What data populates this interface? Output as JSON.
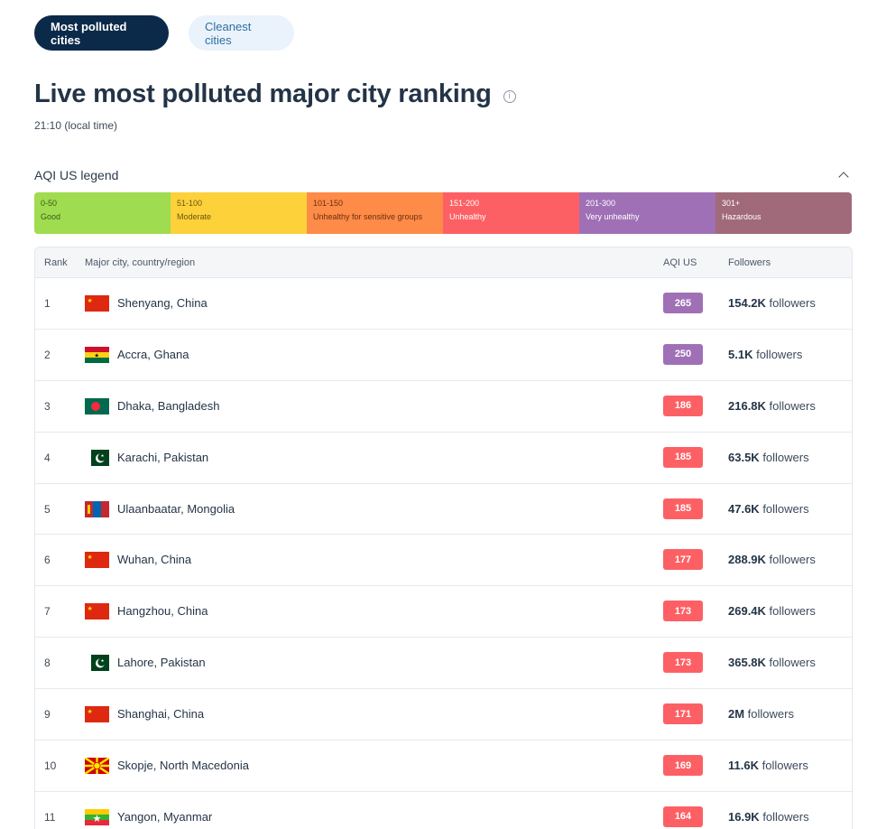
{
  "tabs": [
    {
      "label": "Most polluted cities",
      "active": true
    },
    {
      "label": "Cleanest cities",
      "active": false
    }
  ],
  "title": "Live most polluted major city ranking",
  "local_time": "21:10 (local time)",
  "legend": {
    "title": "AQI US legend",
    "segments": [
      {
        "range": "0-50",
        "label": "Good",
        "color": "#a0dc50",
        "text_color": "#3b5a1a"
      },
      {
        "range": "51-100",
        "label": "Moderate",
        "color": "#fdd13a",
        "text_color": "#6a5510"
      },
      {
        "range": "101-150",
        "label": "Unhealthy for sensitive groups",
        "color": "#fe8b48",
        "text_color": "#6a2f10"
      },
      {
        "range": "151-200",
        "label": "Unhealthy",
        "color": "#fd6064",
        "text_color": "#ffffff"
      },
      {
        "range": "201-300",
        "label": "Very unhealthy",
        "color": "#a070b6",
        "text_color": "#ffffff"
      },
      {
        "range": "301+",
        "label": "Hazardous",
        "color": "#a06a7b",
        "text_color": "#ffffff"
      }
    ]
  },
  "table": {
    "headers": {
      "rank": "Rank",
      "city": "Major city, country/region",
      "aqi": "AQI US",
      "followers": "Followers"
    },
    "followers_suffix": " followers",
    "rows": [
      {
        "rank": "1",
        "city": "Shenyang, China",
        "flag": "china-flag-icon",
        "aqi": "265",
        "aqi_color": "#a070b6",
        "followers": "154.2K"
      },
      {
        "rank": "2",
        "city": "Accra, Ghana",
        "flag": "ghana-flag-icon",
        "aqi": "250",
        "aqi_color": "#a070b6",
        "followers": "5.1K"
      },
      {
        "rank": "3",
        "city": "Dhaka, Bangladesh",
        "flag": "bangladesh-flag-icon",
        "aqi": "186",
        "aqi_color": "#fd6064",
        "followers": "216.8K"
      },
      {
        "rank": "4",
        "city": "Karachi, Pakistan",
        "flag": "pakistan-flag-icon",
        "aqi": "185",
        "aqi_color": "#fd6064",
        "followers": "63.5K"
      },
      {
        "rank": "5",
        "city": "Ulaanbaatar, Mongolia",
        "flag": "mongolia-flag-icon",
        "aqi": "185",
        "aqi_color": "#fd6064",
        "followers": "47.6K"
      },
      {
        "rank": "6",
        "city": "Wuhan, China",
        "flag": "china-flag-icon",
        "aqi": "177",
        "aqi_color": "#fd6064",
        "followers": "288.9K"
      },
      {
        "rank": "7",
        "city": "Hangzhou, China",
        "flag": "china-flag-icon",
        "aqi": "173",
        "aqi_color": "#fd6064",
        "followers": "269.4K"
      },
      {
        "rank": "8",
        "city": "Lahore, Pakistan",
        "flag": "pakistan-flag-icon",
        "aqi": "173",
        "aqi_color": "#fd6064",
        "followers": "365.8K"
      },
      {
        "rank": "9",
        "city": "Shanghai, China",
        "flag": "china-flag-icon",
        "aqi": "171",
        "aqi_color": "#fd6064",
        "followers": "2M"
      },
      {
        "rank": "10",
        "city": "Skopje, North Macedonia",
        "flag": "north-macedonia-flag-icon",
        "aqi": "169",
        "aqi_color": "#fd6064",
        "followers": "11.6K"
      },
      {
        "rank": "11",
        "city": "Yangon, Myanmar",
        "flag": "myanmar-flag-icon",
        "aqi": "164",
        "aqi_color": "#fd6064",
        "followers": "16.9K"
      }
    ]
  }
}
